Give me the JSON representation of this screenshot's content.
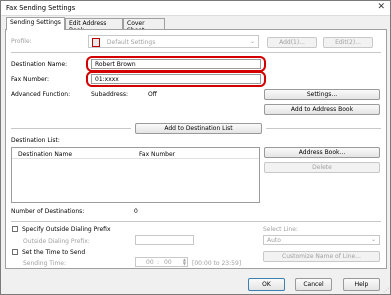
{
  "window": {
    "title": "Fax Sending Settings",
    "close_glyph": "✕"
  },
  "tabs": [
    {
      "label": "Sending Settings",
      "active": true
    },
    {
      "label": "Edit Address Book",
      "active": false
    },
    {
      "label": "Cover Sheet",
      "active": false
    }
  ],
  "profile": {
    "label": "Profile:",
    "value": "Default Settings",
    "add_button": "Add(1)...",
    "edit_button": "Edit(2)..."
  },
  "destination_name": {
    "label": "Destination Name:",
    "value": "Robert Brown"
  },
  "fax_number": {
    "label": "Fax Number:",
    "value": "01:xxxx"
  },
  "advanced": {
    "label": "Advanced Function:",
    "subaddress_label": "Subaddress:",
    "subaddress_value": "Off",
    "settings_button": "Settings...",
    "add_to_address_book_button": "Add to Address Book"
  },
  "add_to_destination_list_button": "Add to Destination List",
  "destination_list": {
    "label": "Destination List:",
    "columns": [
      "Destination Name",
      "Fax Number"
    ],
    "address_book_button": "Address Book...",
    "delete_button": "Delete"
  },
  "number_of_destinations": {
    "label": "Number of Destinations:",
    "value": "0"
  },
  "dialing_prefix": {
    "checkbox_label": "Specify Outside Dialing Prefix",
    "prefix_label": "Outside Dialing Prefix:"
  },
  "send_time": {
    "checkbox_label": "Set the Time to Send",
    "time_label": "Sending Time:",
    "hour": "00",
    "minute": "00",
    "range_hint": "[00:00 to 23:59]"
  },
  "select_line": {
    "label": "Select Line:",
    "value": "Auto",
    "customize_button": "Customize Name of Line..."
  },
  "footer": {
    "ok": "OK",
    "cancel": "Cancel",
    "help": "Help"
  },
  "colors": {
    "highlight": "#d20000",
    "accent_border": "#3c7fb1"
  }
}
